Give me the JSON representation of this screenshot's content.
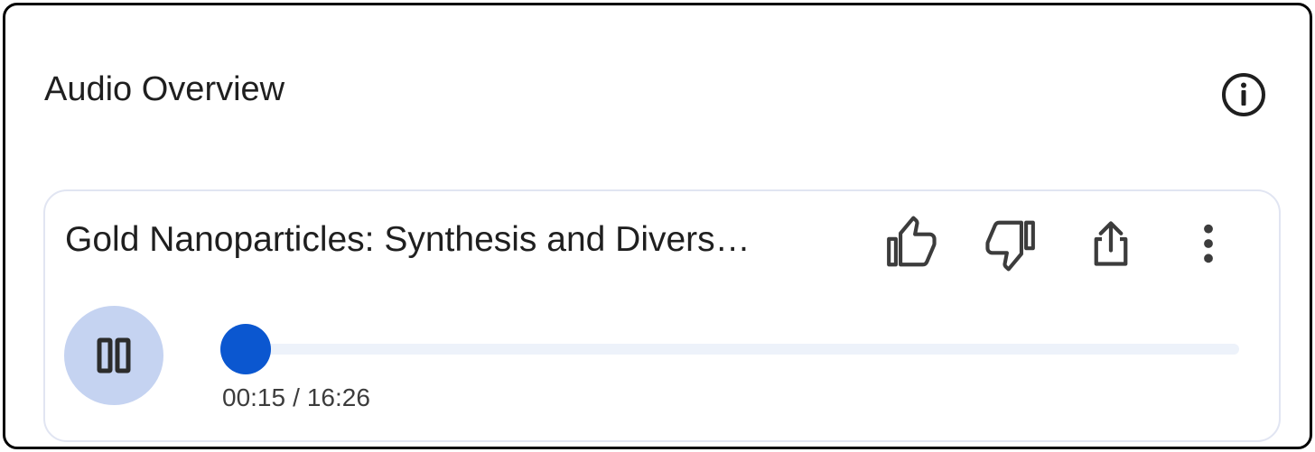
{
  "panel": {
    "title": "Audio Overview",
    "info_icon": "info-icon"
  },
  "player": {
    "track_title": "Gold Nanoparticles: Synthesis and Divers…",
    "actions": {
      "like_icon": "thumbs-up-icon",
      "dislike_icon": "thumbs-down-icon",
      "share_icon": "share-icon",
      "more_icon": "more-vert-icon"
    },
    "state": "playing",
    "pause_icon": "pause-icon",
    "current_time": "00:15",
    "separator": "/",
    "duration": "16:26",
    "progress_fraction": 0.015
  },
  "colors": {
    "accent": "#0b57d0",
    "pause_button_bg": "#c5d3f1",
    "track_bg": "#edf2fa",
    "card_border": "#e1e5f2",
    "text": "#1f1f1f"
  }
}
